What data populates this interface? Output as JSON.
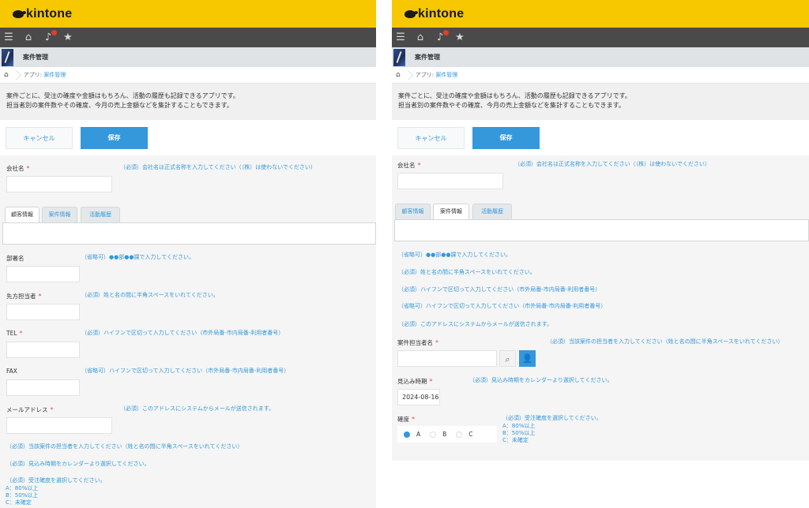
{
  "header": {
    "logo_text": "kintone",
    "nav_icons": [
      "menu-icon",
      "home-icon",
      "bell-icon",
      "star-icon"
    ],
    "app_name": "案件管理"
  },
  "breadcrumb": {
    "prefix": "アプリ: ",
    "app_link": "案件管理"
  },
  "description": {
    "line1": "案件ごとに、受注の確度や金額はもちろん、活動の履歴も記録できるアプリです。",
    "line2": "担当者別の案件数やその確度、今月の売上金額などを集計することもできます。"
  },
  "buttons": {
    "cancel": "キャンセル",
    "save": "保存"
  },
  "fields": {
    "company": {
      "label": "会社名",
      "note": "（必須）会社名は正式名称を入力してください（（株）は使わないでください）"
    },
    "department": {
      "label": "部署名",
      "note": "（省略可）●●部●●課で入力してください。"
    },
    "contact": {
      "label": "先方担当者",
      "note": "（必須）姓と名の間に半角スペースをいれてください。"
    },
    "tel": {
      "label": "TEL",
      "note": "（必須）ハイフンで区切って入力してください（市外局番-市内局番-利用者番号）"
    },
    "fax": {
      "label": "FAX",
      "note": "（省略可）ハイフンで区切って入力してください（市外局番-市内局番-利用者番号）"
    },
    "email": {
      "label": "メールアドレス",
      "note": "（必須）このアドレスにシステムからメールが送信されます。"
    },
    "owner": {
      "label": "案件担当者名",
      "note": "（必須）当該案件の担当者を入力してください（姓と名の間に半角スペースをいれてください）"
    },
    "expected_date": {
      "label": "見込み時期",
      "note": "（必須）見込み時期をカレンダーより選択してください。",
      "value": "2024-08-16"
    },
    "certainty": {
      "label": "確度",
      "note": "（必須）受注確度を選択してください。",
      "legend": [
        "A：80%以上",
        "B：50%以上",
        "C：未確定"
      ],
      "options": [
        "A",
        "B",
        "C"
      ],
      "selected": "A"
    }
  },
  "left_orphan_notes": {
    "owner": "（必須）当該案件の担当者を入力してください（姓と名の間に半角スペースをいれてください）",
    "expected": "（必須）見込み時期をカレンダーより選択してください。",
    "certainty": "（必須）受注確度を選択してください。",
    "legend_a": "A：80%以上",
    "legend_b": "B：50%以上",
    "legend_c": "C：未確定"
  },
  "right_orphan_notes": {
    "department": "（省略可）●●部●●課で入力してください。",
    "contact": "（必須）姓と名の間に半角スペースをいれてください。",
    "tel": "（必須）ハイフンで区切って入力してください（市外局番-市内局番-利用者番号）",
    "fax": "（省略可）ハイフンで区切って入力してください（市外局番-市内局番-利用者番号）",
    "email": "（必須）このアドレスにシステムからメールが送信されます。"
  },
  "tabs": [
    "顧客情報",
    "案件情報",
    "活動履歴"
  ],
  "required_mark": "*",
  "colors": {
    "brand_yellow": "#f7c800",
    "nav_dark": "#4a4a4a",
    "accent_blue": "#3498db",
    "required_red": "#e74c3c"
  }
}
